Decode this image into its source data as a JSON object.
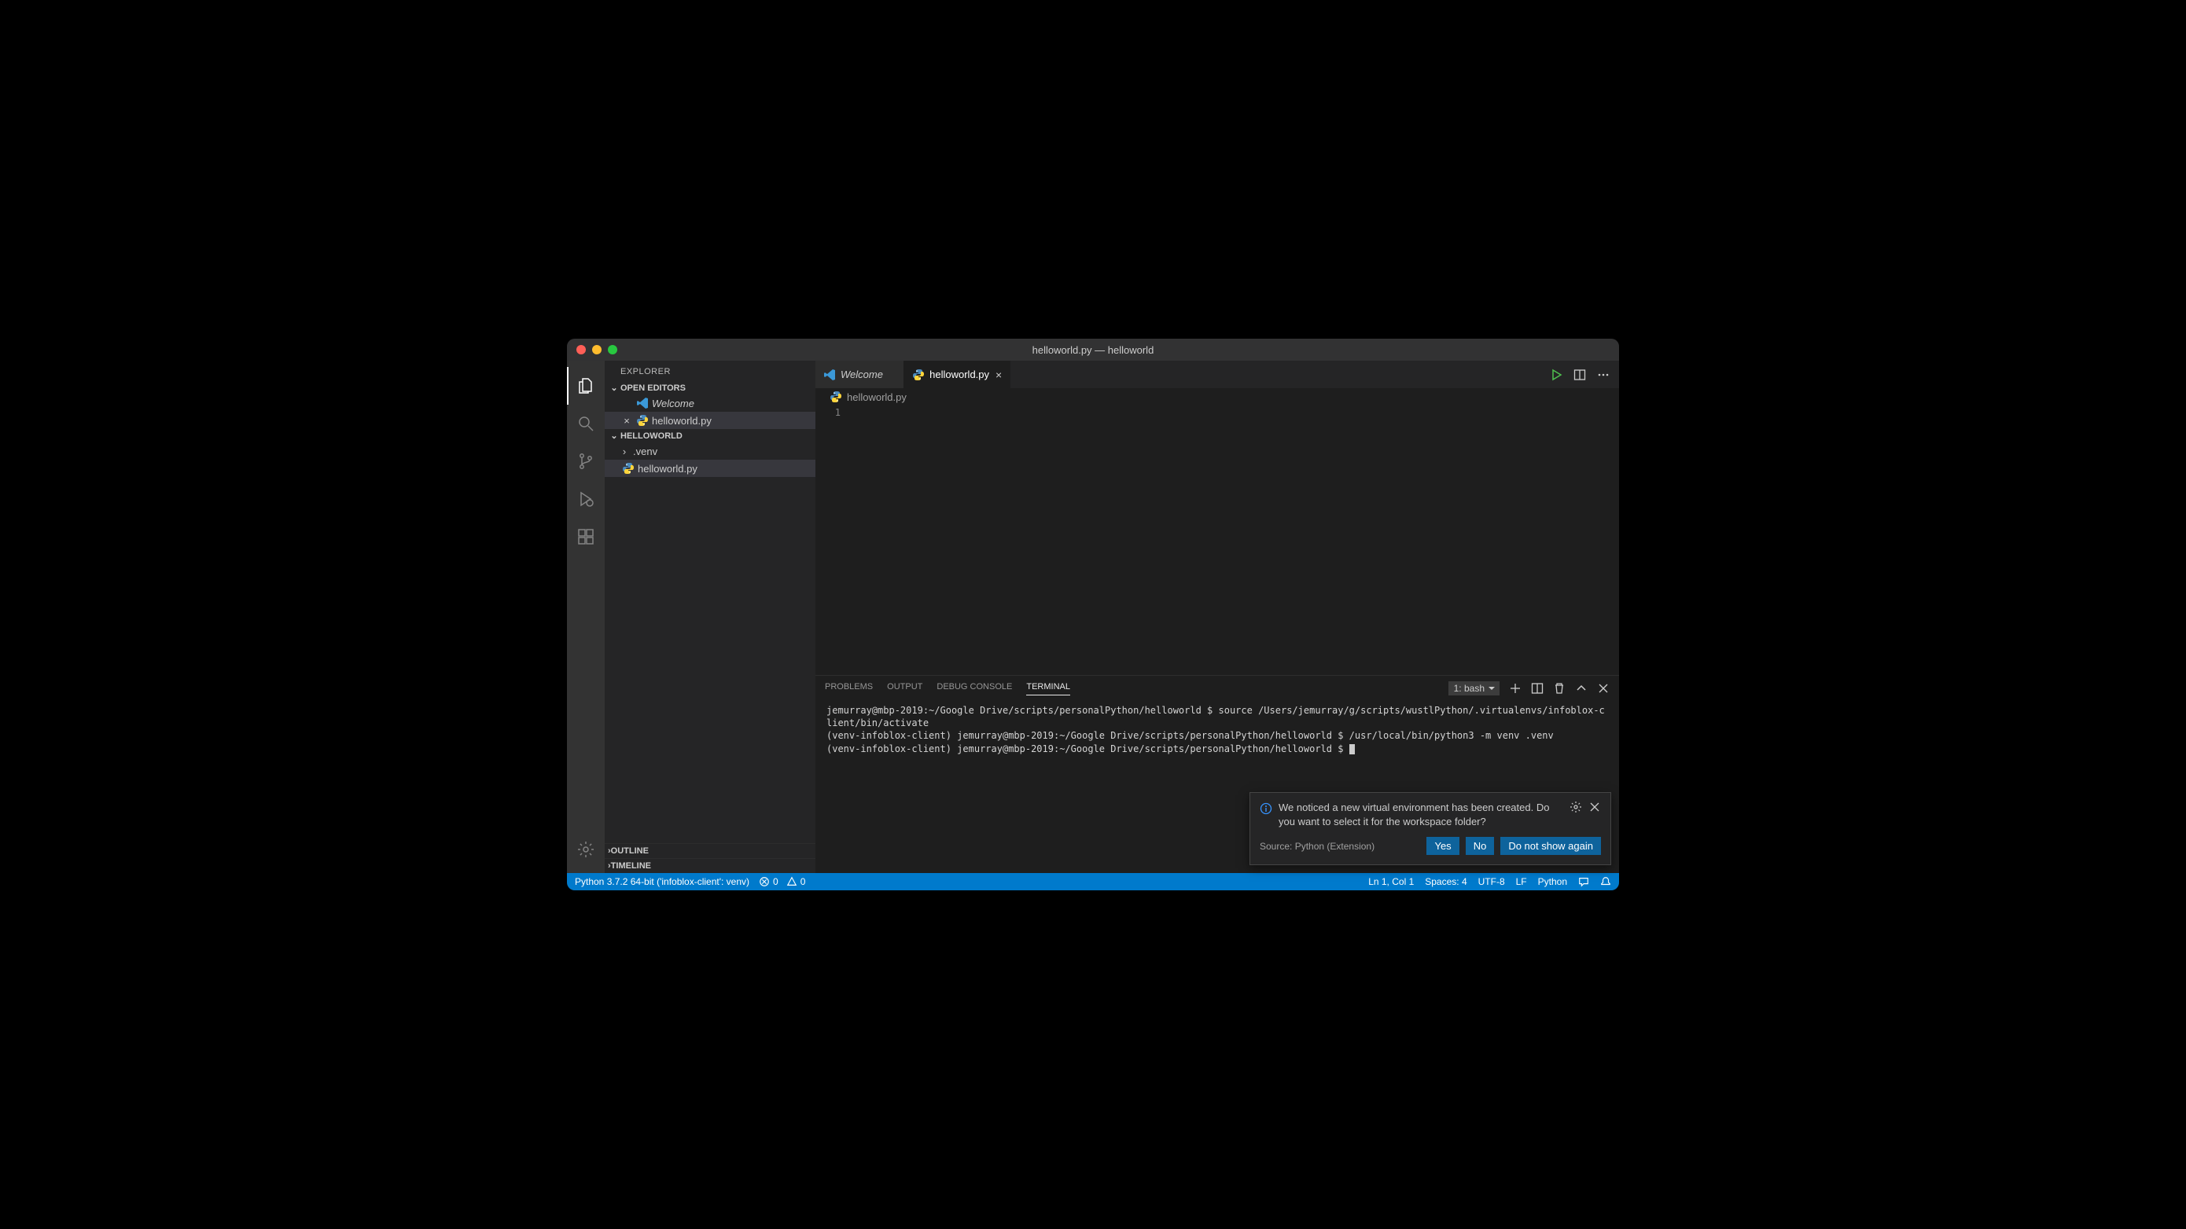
{
  "window": {
    "title": "helloworld.py — helloworld"
  },
  "sidebar": {
    "title": "EXPLORER",
    "openEditors": {
      "label": "OPEN EDITORS",
      "items": [
        {
          "label": "Welcome",
          "italic": true,
          "icon": "vscode-icon"
        },
        {
          "label": "helloworld.py",
          "icon": "python-icon",
          "closeVisible": true
        }
      ]
    },
    "workspace": {
      "label": "HELLOWORLD",
      "items": [
        {
          "label": ".venv",
          "type": "folder"
        },
        {
          "label": "helloworld.py",
          "type": "file",
          "icon": "python-icon",
          "selected": true
        }
      ]
    },
    "outline": "OUTLINE",
    "timeline": "TIMELINE"
  },
  "tabs": [
    {
      "label": "Welcome",
      "icon": "vscode-icon",
      "italic": true,
      "active": false
    },
    {
      "label": "helloworld.py",
      "icon": "python-icon",
      "active": true
    }
  ],
  "breadcrumb": {
    "file": "helloworld.py"
  },
  "editor": {
    "lineNumbers": [
      "1"
    ]
  },
  "panel": {
    "tabs": [
      "PROBLEMS",
      "OUTPUT",
      "DEBUG CONSOLE",
      "TERMINAL"
    ],
    "activeTab": "TERMINAL",
    "terminalSelector": "1: bash",
    "terminalLines": [
      "jemurray@mbp-2019:~/Google Drive/scripts/personalPython/helloworld $ source /Users/jemurray/g/scripts/wustlPython/.virtualenvs/infoblox-client/bin/activate",
      "(venv-infoblox-client) jemurray@mbp-2019:~/Google Drive/scripts/personalPython/helloworld $ /usr/local/bin/python3 -m venv .venv",
      "(venv-infoblox-client) jemurray@mbp-2019:~/Google Drive/scripts/personalPython/helloworld $ "
    ]
  },
  "notification": {
    "message": "We noticed a new virtual environment has been created. Do you want to select it for the workspace folder?",
    "source": "Source: Python (Extension)",
    "buttons": {
      "yes": "Yes",
      "no": "No",
      "dontShow": "Do not show again"
    }
  },
  "statusbar": {
    "python": "Python 3.7.2 64-bit ('infoblox-client': venv)",
    "errors": "0",
    "warnings": "0",
    "cursor": "Ln 1, Col 1",
    "spaces": "Spaces: 4",
    "encoding": "UTF-8",
    "eol": "LF",
    "language": "Python"
  }
}
